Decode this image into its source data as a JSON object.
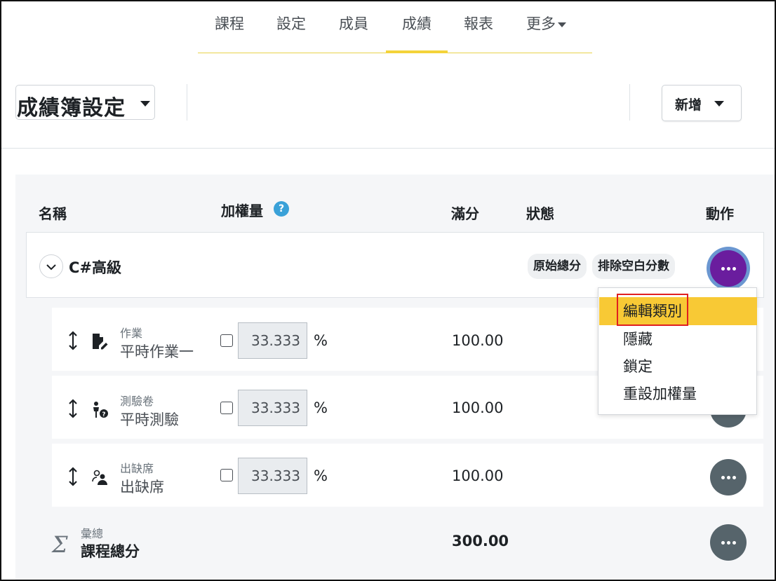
{
  "nav": {
    "tabs": [
      {
        "label": "課程"
      },
      {
        "label": "設定"
      },
      {
        "label": "成員"
      },
      {
        "label": "成績",
        "active": true
      },
      {
        "label": "報表"
      },
      {
        "label": "更多"
      }
    ]
  },
  "header": {
    "page_select": "成績簿設定",
    "add_button": "新增"
  },
  "table": {
    "columns": {
      "name": "名稱",
      "weight": "加權量",
      "max": "滿分",
      "status": "狀態",
      "actions": "動作"
    },
    "help_icon": "?",
    "category": {
      "name": "C#高級",
      "badges": [
        "原始總分",
        "排除空白分數"
      ]
    },
    "items": [
      {
        "type": "作業",
        "name": "平時作業一",
        "icon": "assignment-icon",
        "weight": "33.333",
        "percent": "%",
        "max": "100.00"
      },
      {
        "type": "測驗卷",
        "name": "平時測驗",
        "icon": "quiz-icon",
        "weight": "33.333",
        "percent": "%",
        "max": "100.00"
      },
      {
        "type": "出缺席",
        "name": "出缺席",
        "icon": "attendance-icon",
        "weight": "33.333",
        "percent": "%",
        "max": "100.00"
      }
    ],
    "total": {
      "symbol": "Σ",
      "type": "彙總",
      "name": "課程總分",
      "max": "300.00"
    }
  },
  "menu": {
    "items": [
      {
        "label": "編輯類別",
        "highlighted": true
      },
      {
        "label": "隱藏"
      },
      {
        "label": "鎖定"
      },
      {
        "label": "重設加權量"
      }
    ]
  },
  "colors": {
    "accent_yellow": "#f8c935",
    "active_purple": "#6a1d9e",
    "help_blue": "#3aa1d8",
    "action_gray": "#56646b",
    "highlight_red": "#e01f1f"
  }
}
